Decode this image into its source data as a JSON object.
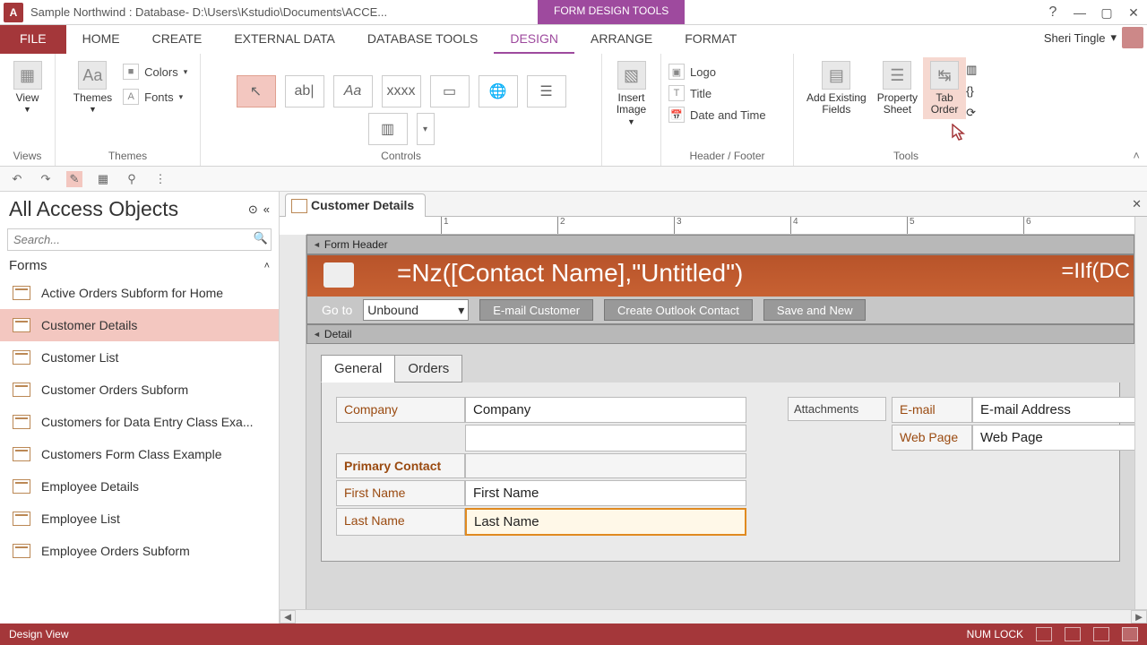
{
  "title": "Sample Northwind : Database- D:\\Users\\Kstudio\\Documents\\ACCE...",
  "context_tab": "FORM DESIGN TOOLS",
  "user_name": "Sheri Tingle",
  "tabs": {
    "file": "FILE",
    "home": "HOME",
    "create": "CREATE",
    "external": "EXTERNAL DATA",
    "dbtools": "DATABASE TOOLS",
    "design": "DESIGN",
    "arrange": "ARRANGE",
    "format": "FORMAT"
  },
  "ribbon": {
    "views": {
      "view": "View",
      "group": "Views"
    },
    "themes": {
      "themes": "Themes",
      "colors": "Colors",
      "fonts": "Fonts",
      "group": "Themes"
    },
    "controls": {
      "group": "Controls"
    },
    "insertimage": {
      "label1": "Insert",
      "label2": "Image"
    },
    "headerfooter": {
      "logo": "Logo",
      "title": "Title",
      "datetime": "Date and Time",
      "group": "Header / Footer"
    },
    "tools": {
      "addfields1": "Add Existing",
      "addfields2": "Fields",
      "propsheet1": "Property",
      "propsheet2": "Sheet",
      "taborder1": "Tab",
      "taborder2": "Order",
      "group": "Tools"
    }
  },
  "nav": {
    "header": "All Access Objects",
    "search_placeholder": "Search...",
    "group": "Forms",
    "items": [
      "Active Orders Subform for Home",
      "Customer Details",
      "Customer List",
      "Customer Orders Subform",
      "Customers for Data Entry Class Exa...",
      "Customers Form Class Example",
      "Employee Details",
      "Employee List",
      "Employee Orders Subform"
    ],
    "selected_index": 1
  },
  "doc": {
    "tab": "Customer Details",
    "sections": {
      "formheader": "Form Header",
      "detail": "Detail"
    },
    "header_title": "=Nz([Contact Name],\"Untitled\")",
    "header_right": "=IIf(DC",
    "toolbar": {
      "goto": "Go to",
      "combo": "Unbound",
      "email": "E-mail Customer",
      "outlook": "Create Outlook Contact",
      "save": "Save and New"
    },
    "tabs": {
      "general": "General",
      "orders": "Orders"
    },
    "fields": {
      "company_l": "Company",
      "company_v": "Company",
      "primary": "Primary Contact",
      "first_l": "First Name",
      "first_v": "First Name",
      "last_l": "Last Name",
      "last_v": "Last Name",
      "attach": "Attachments",
      "email_l": "E-mail",
      "email_v": "E-mail Address",
      "web_l": "Web Page",
      "web_v": "Web Page"
    }
  },
  "status": {
    "mode": "Design View",
    "numlock": "NUM LOCK"
  },
  "ruler_marks": [
    "1",
    "2",
    "3",
    "4",
    "5",
    "6"
  ]
}
